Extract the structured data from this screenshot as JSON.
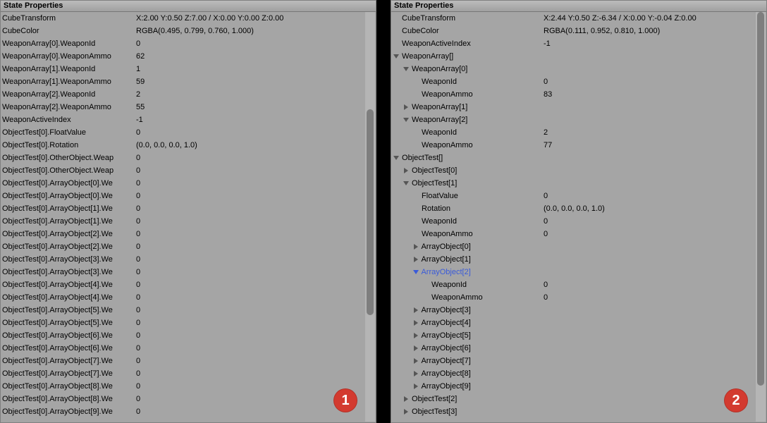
{
  "left": {
    "title": "State Properties",
    "badge": "1",
    "rows": [
      {
        "label": "CubeTransform",
        "value": "X:2.00 Y:0.50 Z:7.00 / X:0.00 Y:0.00 Z:0.00"
      },
      {
        "label": "CubeColor",
        "value": "RGBA(0.495, 0.799, 0.760, 1.000)"
      },
      {
        "label": "WeaponArray[0].WeaponId",
        "value": "0"
      },
      {
        "label": "WeaponArray[0].WeaponAmmo",
        "value": "62"
      },
      {
        "label": "WeaponArray[1].WeaponId",
        "value": "1"
      },
      {
        "label": "WeaponArray[1].WeaponAmmo",
        "value": "59"
      },
      {
        "label": "WeaponArray[2].WeaponId",
        "value": "2"
      },
      {
        "label": "WeaponArray[2].WeaponAmmo",
        "value": "55"
      },
      {
        "label": "WeaponActiveIndex",
        "value": "-1"
      },
      {
        "label": "ObjectTest[0].FloatValue",
        "value": "0"
      },
      {
        "label": "ObjectTest[0].Rotation",
        "value": "(0.0, 0.0, 0.0, 1.0)"
      },
      {
        "label": "ObjectTest[0].OtherObject.Weap",
        "value": "0"
      },
      {
        "label": "ObjectTest[0].OtherObject.Weap",
        "value": "0"
      },
      {
        "label": "ObjectTest[0].ArrayObject[0].We",
        "value": "0"
      },
      {
        "label": "ObjectTest[0].ArrayObject[0].We",
        "value": "0"
      },
      {
        "label": "ObjectTest[0].ArrayObject[1].We",
        "value": "0"
      },
      {
        "label": "ObjectTest[0].ArrayObject[1].We",
        "value": "0"
      },
      {
        "label": "ObjectTest[0].ArrayObject[2].We",
        "value": "0"
      },
      {
        "label": "ObjectTest[0].ArrayObject[2].We",
        "value": "0"
      },
      {
        "label": "ObjectTest[0].ArrayObject[3].We",
        "value": "0"
      },
      {
        "label": "ObjectTest[0].ArrayObject[3].We",
        "value": "0"
      },
      {
        "label": "ObjectTest[0].ArrayObject[4].We",
        "value": "0"
      },
      {
        "label": "ObjectTest[0].ArrayObject[4].We",
        "value": "0"
      },
      {
        "label": "ObjectTest[0].ArrayObject[5].We",
        "value": "0"
      },
      {
        "label": "ObjectTest[0].ArrayObject[5].We",
        "value": "0"
      },
      {
        "label": "ObjectTest[0].ArrayObject[6].We",
        "value": "0"
      },
      {
        "label": "ObjectTest[0].ArrayObject[6].We",
        "value": "0"
      },
      {
        "label": "ObjectTest[0].ArrayObject[7].We",
        "value": "0"
      },
      {
        "label": "ObjectTest[0].ArrayObject[7].We",
        "value": "0"
      },
      {
        "label": "ObjectTest[0].ArrayObject[8].We",
        "value": "0"
      },
      {
        "label": "ObjectTest[0].ArrayObject[8].We",
        "value": "0"
      },
      {
        "label": "ObjectTest[0].ArrayObject[9].We",
        "value": "0"
      }
    ]
  },
  "right": {
    "title": "State Properties",
    "badge": "2",
    "rows": [
      {
        "indent": 0,
        "arrow": "",
        "label": "CubeTransform",
        "value": "X:2.44 Y:0.50 Z:-6.34 / X:0.00 Y:-0.04 Z:0.00"
      },
      {
        "indent": 0,
        "arrow": "",
        "label": "CubeColor",
        "value": "RGBA(0.111, 0.952, 0.810, 1.000)"
      },
      {
        "indent": 0,
        "arrow": "",
        "label": "WeaponActiveIndex",
        "value": "-1"
      },
      {
        "indent": 1,
        "arrow": "down",
        "label": "WeaponArray[]",
        "value": ""
      },
      {
        "indent": 2,
        "arrow": "down",
        "label": "WeaponArray[0]",
        "value": ""
      },
      {
        "indent": 3,
        "arrow": "",
        "label": "WeaponId",
        "value": "0"
      },
      {
        "indent": 3,
        "arrow": "",
        "label": "WeaponAmmo",
        "value": "83"
      },
      {
        "indent": 2,
        "arrow": "right",
        "label": "WeaponArray[1]",
        "value": ""
      },
      {
        "indent": 2,
        "arrow": "down",
        "label": "WeaponArray[2]",
        "value": ""
      },
      {
        "indent": 3,
        "arrow": "",
        "label": "WeaponId",
        "value": "2"
      },
      {
        "indent": 3,
        "arrow": "",
        "label": "WeaponAmmo",
        "value": "77"
      },
      {
        "indent": 1,
        "arrow": "down",
        "label": "ObjectTest[]",
        "value": ""
      },
      {
        "indent": 2,
        "arrow": "right",
        "label": "ObjectTest[0]",
        "value": ""
      },
      {
        "indent": 2,
        "arrow": "down",
        "label": "ObjectTest[1]",
        "value": ""
      },
      {
        "indent": 3,
        "arrow": "",
        "label": "FloatValue",
        "value": "0"
      },
      {
        "indent": 3,
        "arrow": "",
        "label": "Rotation",
        "value": "(0.0, 0.0, 0.0, 1.0)"
      },
      {
        "indent": 3,
        "arrow": "",
        "label": "WeaponId",
        "value": "0"
      },
      {
        "indent": 3,
        "arrow": "",
        "label": "WeaponAmmo",
        "value": "0"
      },
      {
        "indent": 3,
        "arrow": "right",
        "label": "ArrayObject[0]",
        "value": ""
      },
      {
        "indent": 3,
        "arrow": "right",
        "label": "ArrayObject[1]",
        "value": ""
      },
      {
        "indent": 3,
        "arrow": "down",
        "label": "ArrayObject[2]",
        "value": "",
        "selected": true
      },
      {
        "indent": 4,
        "arrow": "",
        "label": "WeaponId",
        "value": "0"
      },
      {
        "indent": 4,
        "arrow": "",
        "label": "WeaponAmmo",
        "value": "0"
      },
      {
        "indent": 3,
        "arrow": "right",
        "label": "ArrayObject[3]",
        "value": ""
      },
      {
        "indent": 3,
        "arrow": "right",
        "label": "ArrayObject[4]",
        "value": ""
      },
      {
        "indent": 3,
        "arrow": "right",
        "label": "ArrayObject[5]",
        "value": ""
      },
      {
        "indent": 3,
        "arrow": "right",
        "label": "ArrayObject[6]",
        "value": ""
      },
      {
        "indent": 3,
        "arrow": "right",
        "label": "ArrayObject[7]",
        "value": ""
      },
      {
        "indent": 3,
        "arrow": "right",
        "label": "ArrayObject[8]",
        "value": ""
      },
      {
        "indent": 3,
        "arrow": "right",
        "label": "ArrayObject[9]",
        "value": ""
      },
      {
        "indent": 2,
        "arrow": "right",
        "label": "ObjectTest[2]",
        "value": ""
      },
      {
        "indent": 2,
        "arrow": "right",
        "label": "ObjectTest[3]",
        "value": ""
      }
    ]
  }
}
